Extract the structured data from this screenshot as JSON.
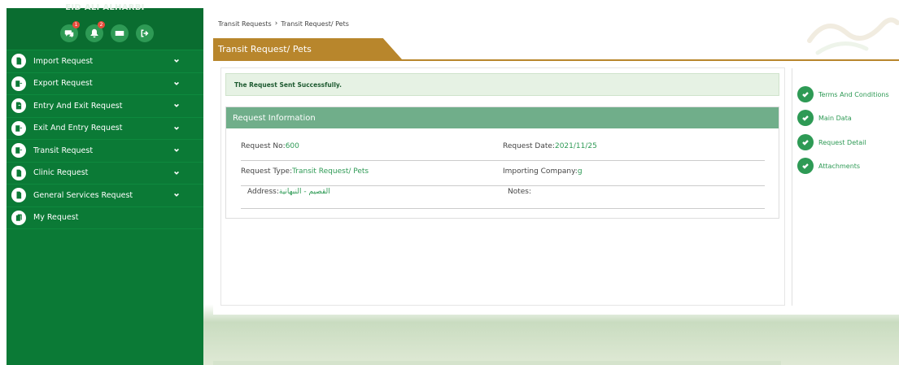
{
  "sidebar": {
    "user_name": "EID ALI ALHARBI",
    "top_icons": [
      {
        "name": "chat-icon",
        "badge": "1"
      },
      {
        "name": "bell-icon",
        "badge": "2"
      },
      {
        "name": "id-card-icon",
        "badge": ""
      },
      {
        "name": "logout-icon",
        "badge": ""
      }
    ],
    "items": [
      {
        "label": "Import Request",
        "icon": "import-icon",
        "has_submenu": true
      },
      {
        "label": "Export Request",
        "icon": "export-icon",
        "has_submenu": true
      },
      {
        "label": "Entry And Exit Request",
        "icon": "entry-exit-icon",
        "has_submenu": true
      },
      {
        "label": "Exit And Entry Request",
        "icon": "exit-entry-icon",
        "has_submenu": true
      },
      {
        "label": "Transit Request",
        "icon": "transit-icon",
        "has_submenu": true
      },
      {
        "label": "Clinic Request",
        "icon": "clinic-icon",
        "has_submenu": true
      },
      {
        "label": "General Services Request",
        "icon": "services-icon",
        "has_submenu": true
      },
      {
        "label": "My Request",
        "icon": "my-request-icon",
        "has_submenu": false
      }
    ]
  },
  "breadcrumb": {
    "first": "Transit Requests",
    "separator": "›",
    "second": "Transit Request/ Pets"
  },
  "page_title": "Transit Request/ Pets",
  "success_message": "The Request Sent Successfully.",
  "request_info": {
    "header": "Request Information",
    "request_no_label": "Request No:",
    "request_no_value": "600",
    "request_date_label": "Request Date:",
    "request_date_value": "2021/11/25",
    "request_type_label": "Request Type:",
    "request_type_value": "Transit Request/ Pets",
    "importing_company_label": "Importing Company:",
    "importing_company_value": "g",
    "address_label": "Address:",
    "address_value": "القصيم - النبهانية",
    "notes_label": "Notes:",
    "notes_value": ""
  },
  "steps": [
    {
      "label": "Terms And Conditions"
    },
    {
      "label": "Main Data"
    },
    {
      "label": "Request Detail"
    },
    {
      "label": "Attachments"
    }
  ],
  "colors": {
    "sidebar_green": "#0b7a36",
    "accent_gold": "#b8862c",
    "header_green": "#70ae8a",
    "success_bg": "#e6f2e4",
    "value_green": "#2e9a55"
  }
}
